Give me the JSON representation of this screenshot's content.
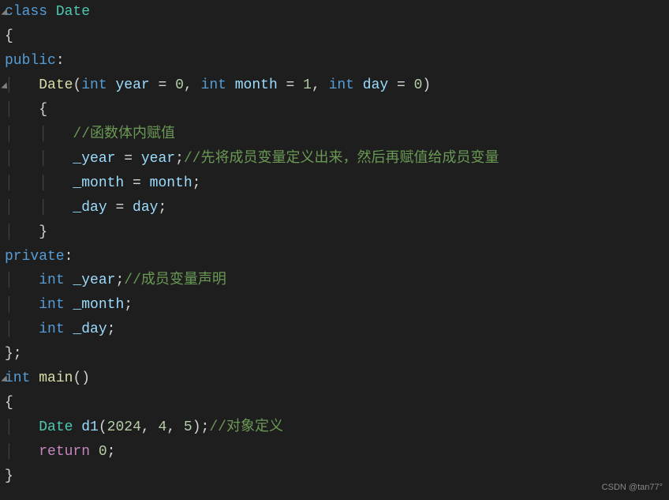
{
  "code": {
    "l1_class": "class",
    "l1_name": "Date",
    "l2_brace": "{",
    "l3_public": "public",
    "l3_colon": ":",
    "l4_func": "Date",
    "l4_lparen": "(",
    "l4_int1": "int",
    "l4_p1": "year",
    "l4_eq1": " = ",
    "l4_n1": "0",
    "l4_c1": ", ",
    "l4_int2": "int",
    "l4_p2": "month",
    "l4_eq2": " = ",
    "l4_n2": "1",
    "l4_c2": ", ",
    "l4_int3": "int",
    "l4_p3": "day",
    "l4_eq3": " = ",
    "l4_n3": "0",
    "l4_rparen": ")",
    "l5_brace": "{",
    "l6_comment": "//函数体内赋值",
    "l7_var": "_year",
    "l7_eq": " = ",
    "l7_rhs": "year",
    "l7_semi": ";",
    "l7_comment": "//先将成员变量定义出来，然后再赋值给成员变量",
    "l8_var": "_month",
    "l8_eq": " = ",
    "l8_rhs": "month",
    "l8_semi": ";",
    "l9_var": "_day",
    "l9_eq": " = ",
    "l9_rhs": "day",
    "l9_semi": ";",
    "l10_brace": "}",
    "l11_private": "private",
    "l11_colon": ":",
    "l12_int": "int",
    "l12_var": "_year",
    "l12_semi": ";",
    "l12_comment": "//成员变量声明",
    "l13_int": "int",
    "l13_var": "_month",
    "l13_semi": ";",
    "l14_int": "int",
    "l14_var": "_day",
    "l14_semi": ";",
    "l15_brace": "};",
    "l16_int": "int",
    "l16_main": "main",
    "l16_parens": "()",
    "l17_brace": "{",
    "l18_type": "Date",
    "l18_var": "d1",
    "l18_lparen": "(",
    "l18_n1": "2024",
    "l18_c1": ", ",
    "l18_n2": "4",
    "l18_c2": ", ",
    "l18_n3": "5",
    "l18_rparen": ")",
    "l18_semi": ";",
    "l18_comment": "//对象定义",
    "l19_return": "return",
    "l19_n": "0",
    "l19_semi": ";",
    "l20_brace": "}"
  },
  "watermark": "CSDN @tan77°"
}
